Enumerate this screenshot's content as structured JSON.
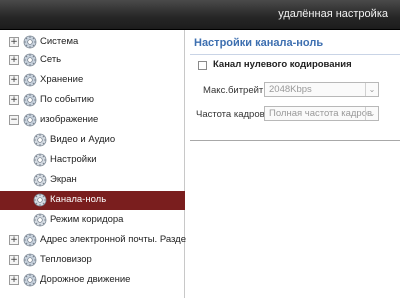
{
  "window": {
    "title": "удалённая настройка"
  },
  "sidebar": {
    "items": [
      {
        "label": "Система",
        "expander": "+",
        "icon": "gear-icon",
        "level": 0
      },
      {
        "label": "Сеть",
        "expander": "+",
        "icon": "gear-icon",
        "level": 0
      },
      {
        "label": "Хранение",
        "expander": "+",
        "icon": "gear-icon",
        "level": 0
      },
      {
        "label": "По событию",
        "expander": "+",
        "icon": "gear-icon",
        "level": 0
      },
      {
        "label": "изображение",
        "expander": "−",
        "icon": "gear-icon",
        "level": 0
      },
      {
        "label": "Видео и Аудио",
        "icon": "gear-icon",
        "level": 1
      },
      {
        "label": "Настройки",
        "icon": "gear-icon",
        "level": 1
      },
      {
        "label": "Экран",
        "icon": "gear-icon",
        "level": 1
      },
      {
        "label": "Канала-ноль",
        "icon": "gear-icon",
        "level": 1,
        "selected": true
      },
      {
        "label": "Режим коридора",
        "icon": "gear-icon",
        "level": 1
      },
      {
        "label": "Адрес электронной почты. Раздел...",
        "expander": "+",
        "icon": "gear-icon",
        "level": 0
      },
      {
        "label": "Тепловизор",
        "expander": "+",
        "icon": "gear-icon",
        "level": 0
      },
      {
        "label": "Дорожное движение",
        "expander": "+",
        "icon": "gear-icon",
        "level": 0
      }
    ]
  },
  "main": {
    "title": "Настройки канала-ноль",
    "checkbox_label": "Канал нулевого кодирования",
    "bitrate_label": "Макс.битрейт:",
    "bitrate_value": "2048Kbps",
    "framerate_label": "Частота кадров:",
    "framerate_value": "Полная частота кадров"
  },
  "colors": {
    "selected_bg": "#7a1e1e",
    "title_blue": "#3d6fb0",
    "titlebar": "#262626"
  }
}
